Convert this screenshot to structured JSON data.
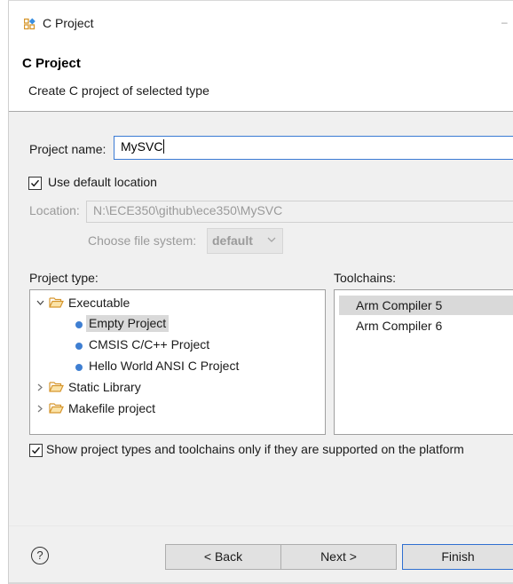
{
  "window": {
    "title": "C Project",
    "title_dash": "–"
  },
  "header": {
    "title": "C Project",
    "subtitle": "Create C project of selected type"
  },
  "project_name": {
    "label": "Project name:",
    "value": "MySVC"
  },
  "use_default_location": {
    "label": "Use default location",
    "checked": true
  },
  "location": {
    "label": "Location:",
    "value": "N:\\ECE350\\github\\ece350\\MySVC"
  },
  "file_system": {
    "label": "Choose file system:",
    "value": "default"
  },
  "project_type": {
    "label": "Project type:",
    "tree": [
      {
        "label": "Executable",
        "kind": "folder",
        "expanded": true
      },
      {
        "label": "Empty Project",
        "kind": "leaf",
        "selected": true
      },
      {
        "label": "CMSIS C/C++ Project",
        "kind": "leaf"
      },
      {
        "label": "Hello World ANSI C Project",
        "kind": "leaf"
      },
      {
        "label": "Static Library",
        "kind": "folder",
        "expanded": false
      },
      {
        "label": "Makefile project",
        "kind": "folder",
        "expanded": false
      }
    ]
  },
  "toolchains": {
    "label": "Toolchains:",
    "items": [
      {
        "label": "Arm Compiler 5",
        "selected": true
      },
      {
        "label": "Arm Compiler 6"
      }
    ]
  },
  "show_supported": {
    "label": "Show project types and toolchains only if they are supported on the platform",
    "checked": true
  },
  "footer": {
    "help": "?",
    "back": "< Back",
    "next": "Next >",
    "finish": "Finish"
  },
  "colors": {
    "accent": "#3b7bd4",
    "selection": "#d9d9d9",
    "folder": "#e3a63a"
  }
}
